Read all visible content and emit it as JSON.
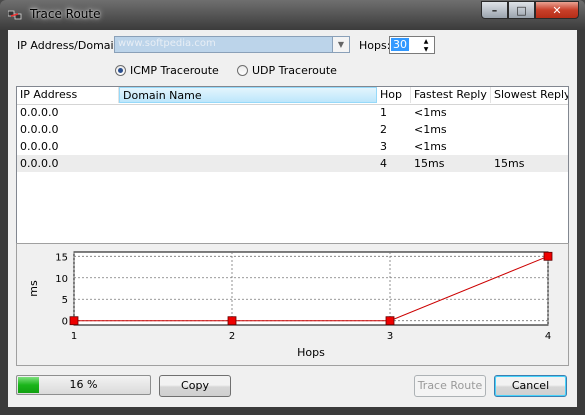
{
  "window": {
    "title": "Trace Route",
    "controls": {
      "minimize": "–",
      "maximize": "□",
      "close": "✕"
    }
  },
  "form": {
    "ip_label": "IP Address/Domain:",
    "ip_value": "www.softpedia.com",
    "hops_label": "Hops:",
    "hops_value": "30",
    "radio_icmp": "ICMP Traceroute",
    "radio_udp": "UDP Traceroute",
    "selected_mode": "icmp"
  },
  "table": {
    "columns": [
      "IP Address",
      "Domain Name",
      "Hop",
      "Fastest Reply",
      "Slowest Reply"
    ],
    "rows": [
      [
        "0.0.0.0",
        "",
        "1",
        "<1ms",
        ""
      ],
      [
        "0.0.0.0",
        "",
        "2",
        "<1ms",
        ""
      ],
      [
        "0.0.0.0",
        "",
        "3",
        "<1ms",
        ""
      ],
      [
        "0.0.0.0",
        "",
        "4",
        "15ms",
        "15ms"
      ]
    ]
  },
  "chart_data": {
    "type": "line",
    "x": [
      1,
      2,
      3,
      4
    ],
    "values": [
      0,
      0,
      0,
      15
    ],
    "xlabel": "Hops",
    "ylabel": "ms",
    "xticks": [
      "1",
      "2",
      "3",
      "4"
    ],
    "yticks": [
      "0",
      "5",
      "10",
      "15"
    ],
    "xlim": [
      1,
      4
    ],
    "ylim": [
      -1,
      16
    ],
    "grid": true,
    "line_color": "#cc0000",
    "marker_color": "#ee0000"
  },
  "progress": {
    "percent": 16,
    "label": "16 %",
    "color": "#1bb51b"
  },
  "buttons": {
    "copy": "Copy",
    "trace": "Trace Route",
    "cancel": "Cancel"
  }
}
